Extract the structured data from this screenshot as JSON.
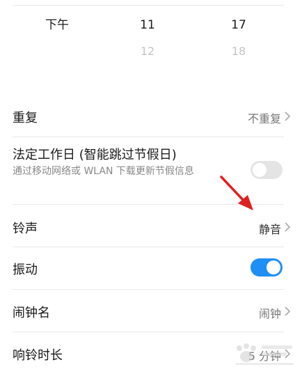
{
  "time_picker": {
    "period_selected": "下午",
    "hour_selected": "11",
    "hour_next": "12",
    "minute_selected": "17",
    "minute_next": "18"
  },
  "settings": {
    "repeat": {
      "label": "重复",
      "value": "不重复"
    },
    "holiday_skip": {
      "label": "法定工作日 (智能跳过节假日)",
      "subtitle": "通过移动网络或 WLAN 下载更新节假信息",
      "enabled": false
    },
    "ringtone": {
      "label": "铃声",
      "value": "静音"
    },
    "vibration": {
      "label": "振动",
      "enabled": true
    },
    "alarm_name": {
      "label": "闹钟名",
      "value": "闹钟"
    },
    "ring_duration": {
      "label": "响铃时长",
      "value": "5 分钟"
    }
  },
  "colors": {
    "toggle_on": "#1e8ff4",
    "toggle_off": "#e4e4e4",
    "annotation_arrow": "#e02020"
  }
}
